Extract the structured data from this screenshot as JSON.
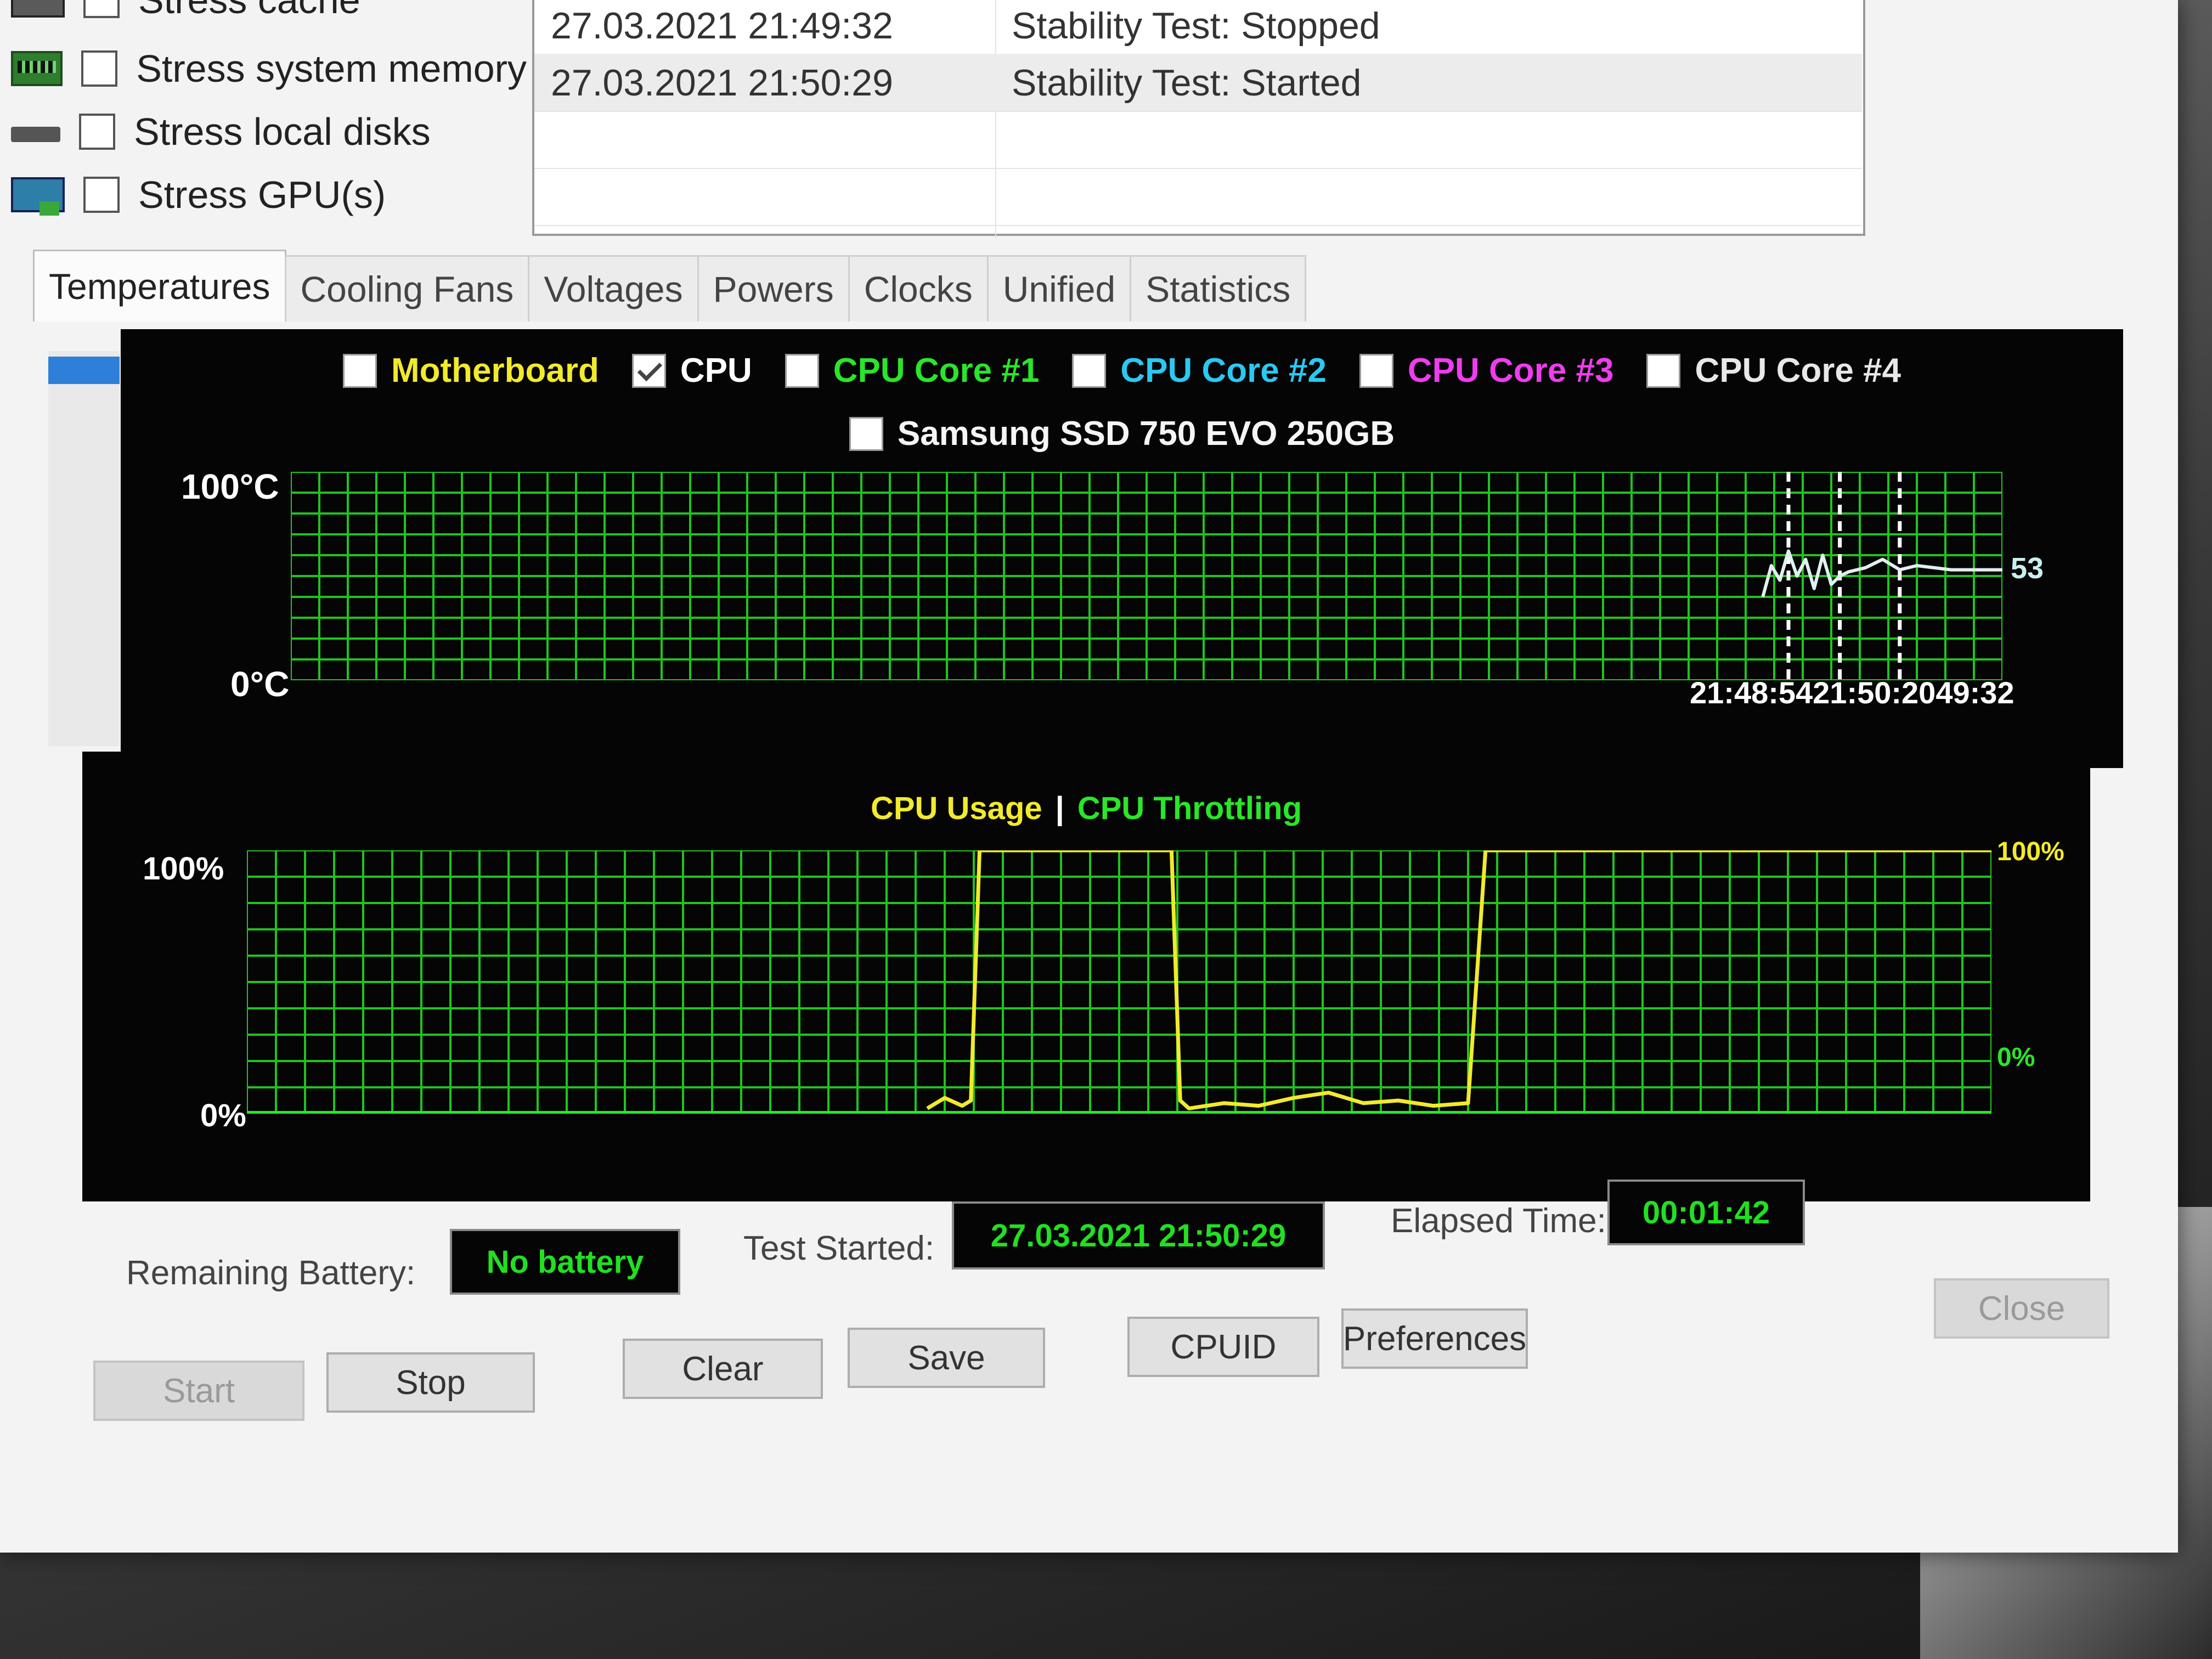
{
  "stress": {
    "items": [
      {
        "label": "Stress cache",
        "icon": "cache-icon"
      },
      {
        "label": "Stress system memory",
        "icon": "memory-icon"
      },
      {
        "label": "Stress local disks",
        "icon": "disk-icon"
      },
      {
        "label": "Stress GPU(s)",
        "icon": "gpu-icon"
      }
    ]
  },
  "log": {
    "rows": [
      {
        "time": "27.03.2021 21:49:32",
        "message": "Stability Test: Stopped"
      },
      {
        "time": "27.03.2021 21:50:29",
        "message": "Stability Test: Started"
      }
    ]
  },
  "tabs": [
    "Temperatures",
    "Cooling Fans",
    "Voltages",
    "Powers",
    "Clocks",
    "Unified",
    "Statistics"
  ],
  "temp_chart": {
    "legend": [
      {
        "label": "Motherboard",
        "color": "#f2ea2a",
        "checked": false
      },
      {
        "label": "CPU",
        "color": "#ffffff",
        "checked": true
      },
      {
        "label": "CPU Core #1",
        "color": "#29e629",
        "checked": false
      },
      {
        "label": "CPU Core #2",
        "color": "#29c9f2",
        "checked": false
      },
      {
        "label": "CPU Core #3",
        "color": "#f03cf0",
        "checked": false
      },
      {
        "label": "CPU Core #4",
        "color": "#e8e8e8",
        "checked": false
      }
    ],
    "legend_row2": {
      "label": "Samsung SSD 750 EVO 250GB",
      "color": "#f5f5f5",
      "checked": false
    },
    "y_max_label": "100°C",
    "y_min_label": "0°C",
    "current_value": "53",
    "time_labels": "21:48:5421:50:2049:32"
  },
  "usage_chart": {
    "title_usage": "CPU Usage",
    "title_sep": "|",
    "title_throttling": "CPU Throttling",
    "y_max_label": "100%",
    "y_min_label": "0%",
    "right_max_label": "100%",
    "right_min_label": "0%"
  },
  "chart_data": [
    {
      "type": "line",
      "title": "",
      "ylim": [
        0,
        100
      ],
      "series": [
        {
          "name": "CPU",
          "color": "#e0f0f0",
          "x": [
            0.86,
            0.865,
            0.87,
            0.875,
            0.88,
            0.885,
            0.89,
            0.895,
            0.9,
            0.905,
            0.91,
            0.92,
            0.93,
            0.94,
            0.95,
            0.97,
            0.99,
            1.0
          ],
          "values": [
            40,
            55,
            48,
            62,
            50,
            58,
            44,
            60,
            46,
            50,
            52,
            54,
            58,
            53,
            55,
            53,
            53,
            53
          ]
        }
      ]
    },
    {
      "type": "line",
      "title": "",
      "ylim": [
        0,
        100
      ],
      "series": [
        {
          "name": "CPU Usage",
          "color": "#f2ea2a",
          "x": [
            0.39,
            0.4,
            0.41,
            0.415,
            0.42,
            0.425,
            0.53,
            0.535,
            0.54,
            0.56,
            0.58,
            0.6,
            0.62,
            0.64,
            0.66,
            0.68,
            0.7,
            0.71,
            0.72,
            1.0
          ],
          "values": [
            2,
            6,
            3,
            5,
            100,
            100,
            100,
            5,
            2,
            4,
            3,
            6,
            8,
            4,
            5,
            3,
            4,
            100,
            100,
            100
          ]
        },
        {
          "name": "CPU Throttling",
          "color": "#29e629",
          "x": [
            0,
            1
          ],
          "values": [
            0,
            0
          ]
        }
      ]
    }
  ],
  "status": {
    "battery_label": "Remaining Battery:",
    "battery_value": "No battery",
    "started_label": "Test Started:",
    "started_value": "27.03.2021 21:50:29",
    "elapsed_label": "Elapsed Time:",
    "elapsed_value": "00:01:42"
  },
  "buttons": {
    "start": "Start",
    "stop": "Stop",
    "clear": "Clear",
    "save": "Save",
    "cpuid": "CPUID",
    "preferences": "Preferences",
    "close": "Close"
  }
}
